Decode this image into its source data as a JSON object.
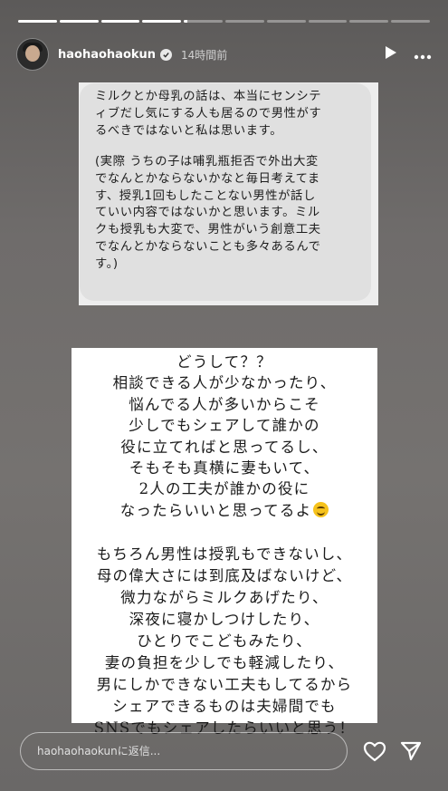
{
  "story": {
    "username": "haohaohaokun",
    "time_ago": "14時間前",
    "progress": [
      1,
      1,
      1,
      1,
      0.1,
      0,
      0,
      0,
      0,
      0
    ]
  },
  "question_lines_1": [
    "ミルクとか母乳の話は、本当にセンシテ",
    "ィブだし気にする人も居るので男性がす",
    "るべきではないと私は思います。"
  ],
  "question_lines_2": [
    "(実際 うちの子は哺乳瓶拒否で外出大変",
    "でなんとかならないかなと毎日考えてま",
    "す、授乳1回もしたことない男性が話し",
    "ていい内容ではないかと思います。ミル",
    "クも授乳も大変で、男性がいう創意工夫",
    "でなんとかならないことも多々あるんで",
    "す。)"
  ],
  "answer_lines_1": [
    "どうして？？",
    "相談できる人が少なかったり、",
    "悩んでる人が多いからこそ",
    "少しでもシェアして誰かの",
    "役に立てればと思ってるし、",
    "そもそも真横に妻もいて、",
    "2人の工夫が誰かの役に",
    "なったらいいと思ってるよ"
  ],
  "answer_lines_2": [
    "もちろん男性は授乳もできないし、",
    "母の偉大さには到底及ばないけど、",
    "微力ながらミルクあげたり、",
    "深夜に寝かしつけしたり、",
    "ひとりでこどもみたり、",
    "妻の負担を少しでも軽減したり、",
    "男にしかできない工夫もしてるから",
    "シェアできるものは夫婦間でも",
    "SNSでもシェアしたらいいと思う！"
  ],
  "reply": {
    "placeholder": "haohaohaokunに返信..."
  },
  "icons": {
    "emoji": "smiling-face-emoji",
    "verified": "verified-badge-icon",
    "play": "play-icon",
    "more": "more-options-icon",
    "heart": "heart-icon",
    "send": "send-icon"
  }
}
